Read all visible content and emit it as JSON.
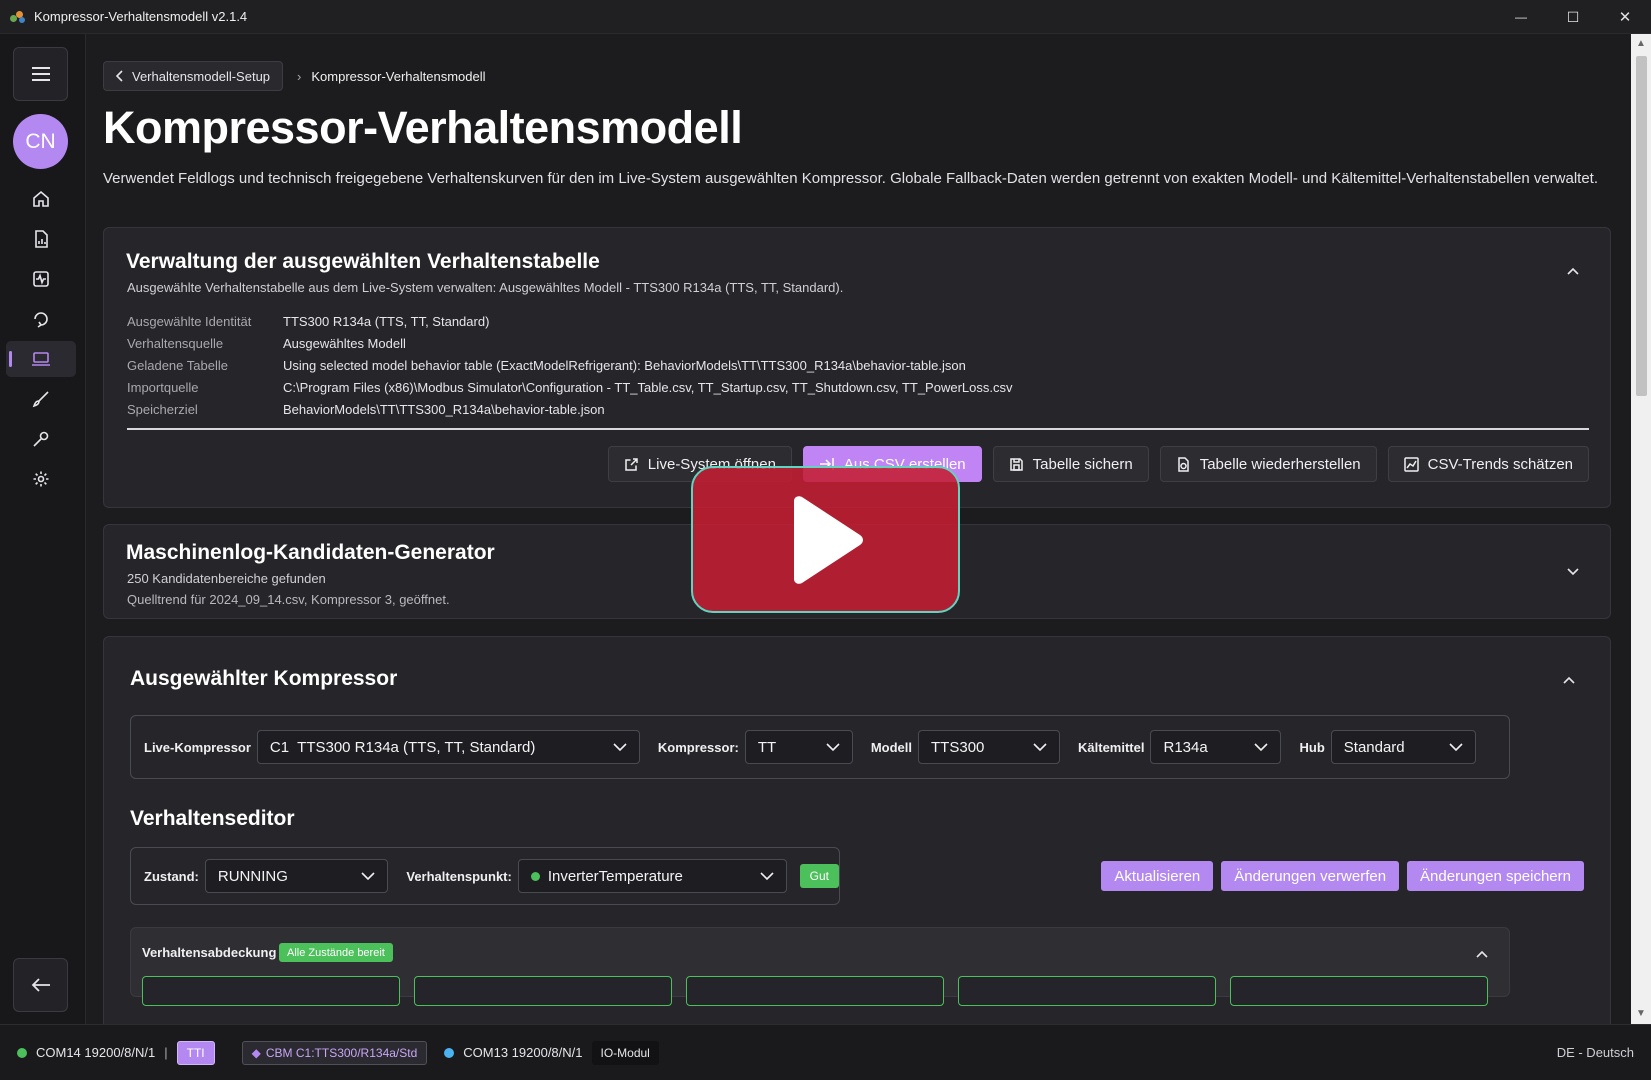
{
  "window": {
    "title": "Kompressor-Verhaltensmodell v2.1.4",
    "minimize": "—",
    "maximize": "☐",
    "close": "✕"
  },
  "sidebar": {
    "avatar_initials": "CN"
  },
  "breadcrumb": {
    "back_label": "Verhaltensmodell-Setup",
    "separator": "›",
    "current": "Kompressor-Verhaltensmodell"
  },
  "page": {
    "title": "Kompressor-Verhaltensmodell",
    "description": "Verwendet Feldlogs und technisch freigegebene Verhaltenskurven für den im Live-System ausgewählten Kompressor. Globale Fallback-Daten werden getrennt von exakten Modell- und Kältemittel-Verhaltenstabellen verwaltet."
  },
  "table_card": {
    "title": "Verwaltung der ausgewählten Verhaltenstabelle",
    "subtitle": "Ausgewählte Verhaltenstabelle aus dem Live-System verwalten: Ausgewähltes Modell - TTS300 R134a (TTS, TT, Standard).",
    "rows": [
      {
        "key": "Ausgewählte Identität",
        "value": "TTS300 R134a (TTS, TT, Standard)"
      },
      {
        "key": "Verhaltensquelle",
        "value": "Ausgewähltes Modell"
      },
      {
        "key": "Geladene Tabelle",
        "value": "Using selected model behavior table (ExactModelRefrigerant): BehaviorModels\\TT\\TTS300_R134a\\behavior-table.json"
      },
      {
        "key": "Importquelle",
        "value": "C:\\Program Files (x86)\\Modbus Simulator\\Configuration - TT_Table.csv, TT_Startup.csv, TT_Shutdown.csv, TT_PowerLoss.csv"
      },
      {
        "key": "Speicherziel",
        "value": "BehaviorModels\\TT\\TTS300_R134a\\behavior-table.json"
      }
    ],
    "buttons": {
      "open_live": "Live-System öffnen",
      "from_csv": "Aus CSV erstellen",
      "save_table": "Tabelle sichern",
      "restore_table": "Tabelle wiederherstellen",
      "estimate_trends": "CSV-Trends schätzen"
    }
  },
  "generator_card": {
    "title": "Maschinenlog-Kandidaten-Generator",
    "line1": "250 Kandidatenbereiche gefunden",
    "line2": "Quelltrend für 2024_09_14.csv, Kompressor 3, geöffnet."
  },
  "compressor_card": {
    "title": "Ausgewählter Kompressor",
    "live_label": "Live-Kompressor",
    "live_value": "C1  TTS300 R134a (TTS, TT, Standard)",
    "comp_label": "Kompressor:",
    "comp_value": "TT",
    "model_label": "Modell",
    "model_value": "TTS300",
    "refrigerant_label": "Kältemittel",
    "refrigerant_value": "R134a",
    "hub_label": "Hub",
    "hub_value": "Standard",
    "editor_title": "Verhaltenseditor",
    "state_label": "Zustand:",
    "state_value": "RUNNING",
    "point_label": "Verhaltenspunkt:",
    "point_value": "InverterTemperature",
    "point_status": "Gut",
    "refresh": "Aktualisieren",
    "discard": "Änderungen verwerfen",
    "save": "Änderungen speichern",
    "coverage_label": "Verhaltensabdeckung",
    "coverage_badge": "Alle Zustände bereit"
  },
  "statusbar": {
    "com1": "COM14 19200/8/N/1",
    "sep": "|",
    "tt_tag": "TTI",
    "cbm_tag": "CBM C1:TTS300/R134a/Std",
    "com2": "COM13 19200/8/N/1",
    "io_tag": "IO-Modul",
    "language": "DE - Deutsch"
  },
  "colors": {
    "accent": "#b388f0",
    "good": "#4cc05a",
    "status_green": "#4cc05a",
    "status_blue": "#4ab3f0"
  }
}
